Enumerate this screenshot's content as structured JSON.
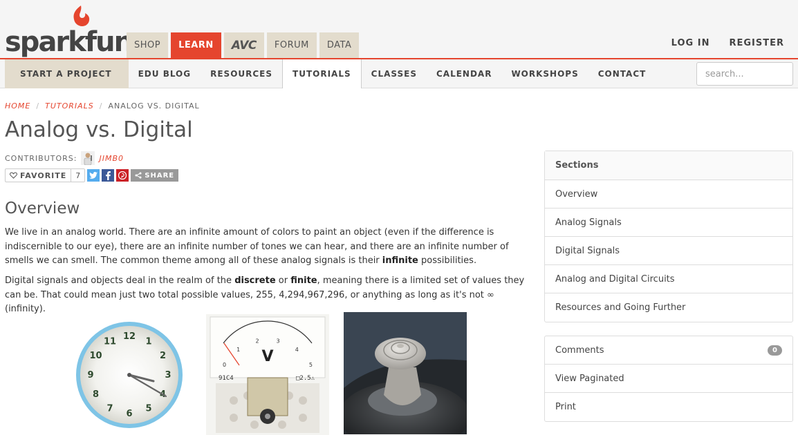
{
  "logo": {
    "text": "sparkfun"
  },
  "main_tabs": [
    "SHOP",
    "LEARN",
    "AVC",
    "FORUM",
    "DATA"
  ],
  "account": {
    "login": "LOG IN",
    "register": "REGISTER"
  },
  "subnav": [
    "START A PROJECT",
    "EDU BLOG",
    "RESOURCES",
    "TUTORIALS",
    "CLASSES",
    "CALENDAR",
    "WORKSHOPS",
    "CONTACT"
  ],
  "search": {
    "placeholder": "search..."
  },
  "breadcrumb": {
    "home": "HOME",
    "tutorials": "TUTORIALS",
    "current": "ANALOG VS. DIGITAL",
    "sep": "/"
  },
  "page": {
    "title": "Analog vs. Digital",
    "contributors_label": "CONTRIBUTORS:",
    "contributor": "JIMB0",
    "favorite_label": "FAVORITE",
    "favorite_count": "7",
    "share_label": "SHARE",
    "section_title": "Overview",
    "p1_a": "We live in an analog world. There are an infinite amount of colors to paint an object (even if the difference is indiscernible to our eye), there are an infinite number of tones we can hear, and there are an infinite number of smells we can smell. The common theme among all of these analog signals is their ",
    "p1_b": "infinite",
    "p1_c": " possibilities.",
    "p2_a": "Digital signals and objects deal in the realm of the ",
    "p2_b": "discrete",
    "p2_c": " or ",
    "p2_d": "finite",
    "p2_e": ", meaning there is a limited set of values they can be. That could mean just two total possible values, 255, 4,294,967,296, or anything as long as it's not ∞ (infinity)."
  },
  "clock": {
    "numbers": [
      "12",
      "1",
      "2",
      "3",
      "4",
      "5",
      "6",
      "7",
      "8",
      "9",
      "10",
      "11"
    ]
  },
  "meter": {
    "scale": [
      "0",
      "1",
      "2",
      "3",
      "4",
      "5"
    ],
    "unit": "V",
    "model": "91C4",
    "spec": "□2.5⚠"
  },
  "sidebar": {
    "sections_title": "Sections",
    "sections": [
      "Overview",
      "Analog Signals",
      "Digital Signals",
      "Analog and Digital Circuits",
      "Resources and Going Further"
    ],
    "comments_label": "Comments",
    "comments_count": "0",
    "paginated_label": "View Paginated",
    "print_label": "Print"
  },
  "colors": {
    "accent": "#e5452e",
    "tab_bg": "#e3dccd",
    "twitter": "#55acee",
    "facebook": "#3b5998",
    "pinterest": "#cb2027"
  }
}
